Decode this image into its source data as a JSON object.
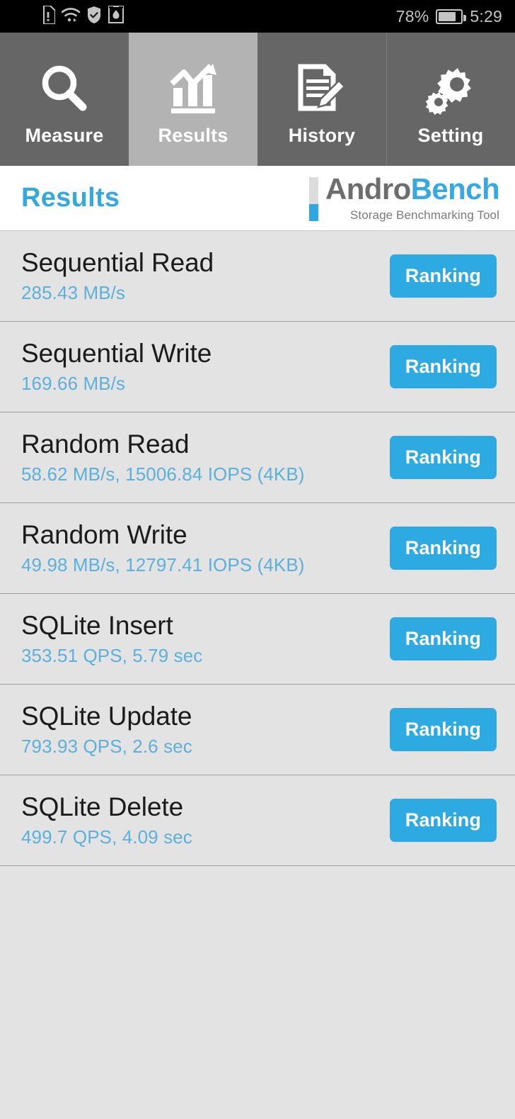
{
  "statusbar": {
    "icons": [
      "sd-card-alert-icon",
      "wifi-icon",
      "shield-check-icon",
      "huawei-hiapp-icon"
    ],
    "battery_percent_label": "78%",
    "battery_level": 78,
    "battery_icon": "battery-icon",
    "clock": "5:29"
  },
  "tabs": [
    {
      "label": "Measure",
      "icon": "magnifier-icon",
      "active": false
    },
    {
      "label": "Results",
      "icon": "bar-chart-trend-icon",
      "active": true
    },
    {
      "label": "History",
      "icon": "document-pencil-icon",
      "active": false
    },
    {
      "label": "Setting",
      "icon": "gears-icon",
      "active": false
    }
  ],
  "header": {
    "page_title": "Results",
    "logo": {
      "word_primary": "Andro",
      "word_secondary": "Bench",
      "subtitle": "Storage Benchmarking Tool"
    }
  },
  "results": {
    "rank_button_label": "Ranking",
    "rows": [
      {
        "title": "Sequential Read",
        "value": "285.43 MB/s"
      },
      {
        "title": "Sequential Write",
        "value": "169.66 MB/s"
      },
      {
        "title": "Random Read",
        "value": "58.62 MB/s, 15006.84 IOPS (4KB)"
      },
      {
        "title": "Random Write",
        "value": "49.98 MB/s, 12797.41 IOPS (4KB)"
      },
      {
        "title": "SQLite Insert",
        "value": "353.51 QPS, 5.79 sec"
      },
      {
        "title": "SQLite Update",
        "value": "793.93 QPS, 2.6 sec"
      },
      {
        "title": "SQLite Delete",
        "value": "499.7 QPS, 4.09 sec"
      }
    ]
  },
  "colors": {
    "accent_blue": "#35a8dd",
    "button_blue": "#2daae1",
    "value_blue": "#5cb0d9",
    "tab_inactive": "#666666",
    "tab_active": "#b3b3b3",
    "list_background": "#e3e3e3",
    "statusbar_background": "#000000"
  }
}
